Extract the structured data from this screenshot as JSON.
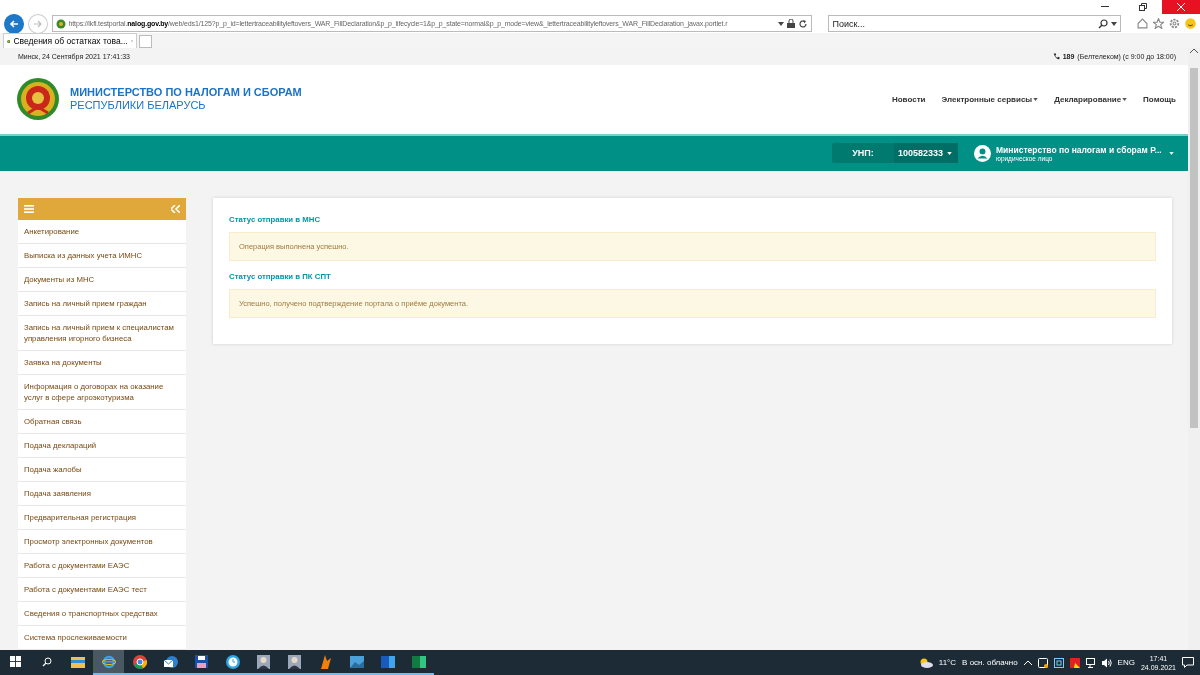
{
  "browser": {
    "url": "https://lkfl.testportal.**nalog.gov.by**/web/eds1/125?p_p_id=lettertraceabilityleftovers_WAR_FillDeclaration&p_p_lifecycle=1&p_p_state=normal&p_p_mode=view&_lettertraceabilityleftovers_WAR_FillDeclaration_javax.portlet.r",
    "search_placeholder": "Поиск...",
    "tabs": [
      {
        "title": "Сведения об остатках това...",
        "selected": true
      }
    ]
  },
  "top_strip": {
    "datetime": "Минск, 24 Сентября 2021 17:41:33",
    "phone_number": "189",
    "phone_note": "(Белтелеком) (с 9:00 до 18:00)"
  },
  "header": {
    "title_line_1": "МИНИСТЕРСТВО ПО НАЛОГАМ И СБОРАМ",
    "title_line_2": "РЕСПУБЛИКИ БЕЛАРУСЬ",
    "nav": [
      {
        "label": "Новости",
        "dropdown": false
      },
      {
        "label": "Электронные сервисы",
        "dropdown": true
      },
      {
        "label": "Декларирование",
        "dropdown": true
      },
      {
        "label": "Помощь",
        "dropdown": false
      }
    ]
  },
  "account_bar": {
    "unp_label": "УНП:",
    "unp_value": "100582333",
    "user_name": "Министерство по налогам и сборам Р...",
    "user_role": "юридическое лицо"
  },
  "sidebar": {
    "items": [
      {
        "label": "Анкетирование"
      },
      {
        "label": "Выписка из данных учета ИМНС"
      },
      {
        "label": "Документы из МНС"
      },
      {
        "label": "Запись на личный прием граждан"
      },
      {
        "label": "Запись на личный прием к специалистам управления игорного бизнеса"
      },
      {
        "label": "Заявка на документы"
      },
      {
        "label": "Информация о договорах на оказание услуг в сфере агроэкотуризма"
      },
      {
        "label": "Обратная связь"
      },
      {
        "label": "Подача деклараций"
      },
      {
        "label": "Подача жалобы"
      },
      {
        "label": "Подача заявления"
      },
      {
        "label": "Предварительная регистрация"
      },
      {
        "label": "Просмотр электронных документов"
      },
      {
        "label": "Работа с документами ЕАЭС"
      },
      {
        "label": "Работа с документами ЕАЭС тест"
      },
      {
        "label": "Сведения о транспортных средствах"
      },
      {
        "label": "Система прослеживаемости"
      }
    ]
  },
  "status_sections": [
    {
      "title": "Статус отправки в МНС",
      "message": "Операция выполнена успешно."
    },
    {
      "title": "Статус отправки в ПК СПТ",
      "message": "Успешно, получено подтверждение портала о приёме документа."
    }
  ],
  "taskbar": {
    "apps": [
      {
        "kind": "explorer",
        "selected": false,
        "running": false
      },
      {
        "kind": "ie",
        "selected": true,
        "running": true
      },
      {
        "kind": "chrome",
        "selected": false,
        "running": true
      },
      {
        "kind": "mail",
        "selected": false,
        "running": true
      },
      {
        "kind": "save",
        "selected": false,
        "running": true
      },
      {
        "kind": "clock",
        "selected": false,
        "running": true
      },
      {
        "kind": "person",
        "selected": false,
        "running": true
      },
      {
        "kind": "person",
        "selected": false,
        "running": true
      },
      {
        "kind": "flame",
        "selected": false,
        "running": true
      },
      {
        "kind": "photo",
        "selected": false,
        "running": true
      },
      {
        "kind": "word",
        "selected": false,
        "running": true
      },
      {
        "kind": "excel",
        "selected": false,
        "running": true
      }
    ],
    "temperature": "11°C",
    "weather": "В осн. облачно",
    "language": "ENG",
    "time": "17:41",
    "date": "24.09.2021"
  }
}
